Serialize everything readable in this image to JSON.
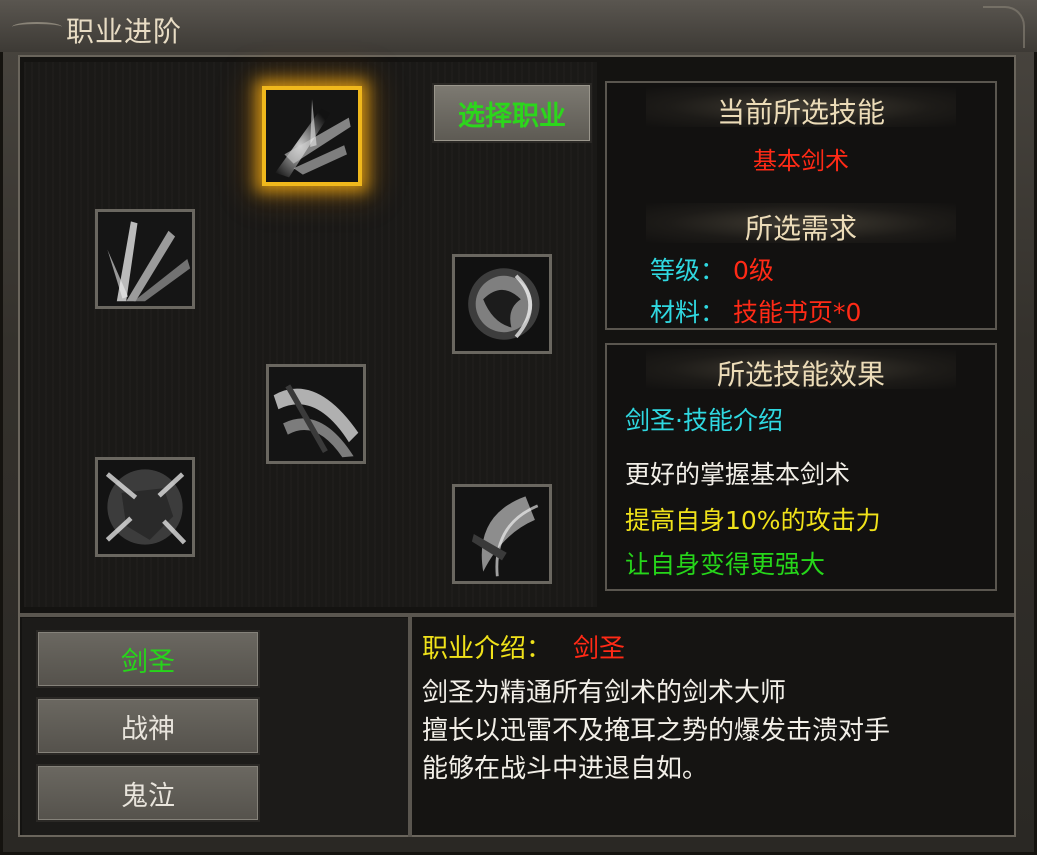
{
  "window": {
    "title": "职业进阶"
  },
  "select_button": {
    "label": "选择职业"
  },
  "skills": [
    {
      "name": "skill-slash-burst",
      "selected": true
    },
    {
      "name": "skill-blade-fan",
      "selected": false
    },
    {
      "name": "skill-orb-strike",
      "selected": false
    },
    {
      "name": "skill-sweep-slash",
      "selected": false
    },
    {
      "name": "skill-fist-smash",
      "selected": false
    },
    {
      "name": "skill-crescent-wind",
      "selected": false
    }
  ],
  "current_skill_panel": {
    "header": "当前所选技能",
    "skill_name": "基本剑术",
    "requirements_header": "所选需求",
    "level_label": "等级：",
    "level_value": "0级",
    "material_label": "材料：",
    "material_value": "技能书页*0"
  },
  "effect_panel": {
    "header": "所选技能效果",
    "intro_title": "剑圣·技能介绍",
    "line1": "更好的掌握基本剑术",
    "line2": "提高自身10%的攻击力",
    "line3": "让自身变得更强大"
  },
  "classes": [
    {
      "label": "剑圣",
      "active": true
    },
    {
      "label": "战神",
      "active": false
    },
    {
      "label": "鬼泣",
      "active": false
    }
  ],
  "class_intro": {
    "label": "职业介绍：",
    "name": "剑圣",
    "line1": "剑圣为精通所有剑术的剑术大师",
    "line2": "擅长以迅雷不及掩耳之势的爆发击溃对手",
    "line3": "能够在战斗中进退自如。"
  },
  "colors": {
    "accent_green": "#26d61a",
    "accent_red": "#ff2a16",
    "accent_cyan": "#2fd8e0",
    "accent_yellow": "#f0e21a",
    "selected_gold": "#f0b81c"
  }
}
